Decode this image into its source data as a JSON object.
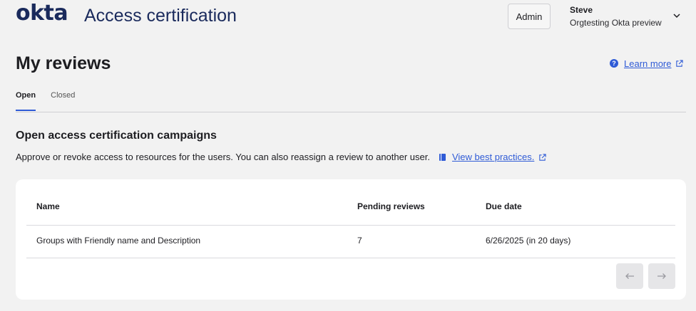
{
  "header": {
    "logo_text": "okta",
    "app_title": "Access certification",
    "admin_label": "Admin",
    "user_name": "Steve",
    "user_org": "Orgtesting Okta preview"
  },
  "page": {
    "title": "My reviews",
    "learn_more": "Learn more"
  },
  "tabs": [
    {
      "label": "Open",
      "active": true
    },
    {
      "label": "Closed",
      "active": false
    }
  ],
  "section": {
    "title": "Open access certification campaigns",
    "description": "Approve or revoke access to resources for the users. You can also reassign a review to another user.",
    "best_practices_link": "View best practices."
  },
  "table": {
    "columns": [
      "Name",
      "Pending reviews",
      "Due date"
    ],
    "rows": [
      {
        "name": "Groups with Friendly name and Description",
        "pending": "7",
        "due": "6/26/2025 (in 20 days)"
      }
    ]
  },
  "colors": {
    "brand": "#1a2a5c",
    "link": "#2f5bd6",
    "background": "#f2f2f2"
  },
  "icons": [
    "help-icon",
    "external-link-icon",
    "book-icon",
    "chevron-down-icon",
    "arrow-left-icon",
    "arrow-right-icon"
  ]
}
